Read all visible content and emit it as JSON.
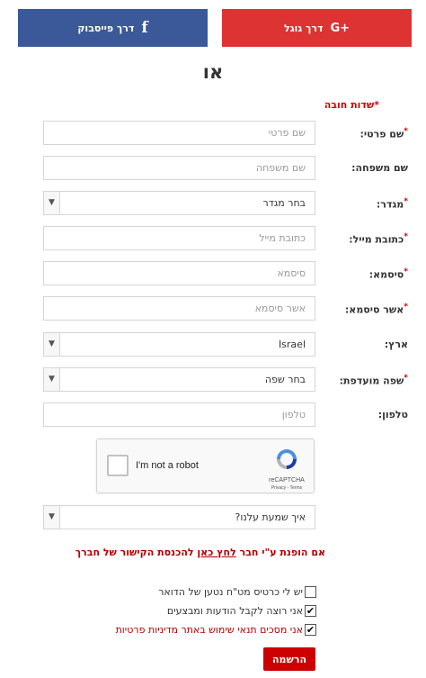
{
  "social": {
    "facebook_label": "דרך פייסבוק",
    "facebook_icon": "f",
    "google_label": "דרך גוגל",
    "google_icon": "G+",
    "facebook_color": "#3b5998",
    "google_color": "#dd3333"
  },
  "or_label": "או",
  "required_note": "שדות חובה",
  "fields": {
    "first_name": {
      "label": "שם פרטי:",
      "placeholder": "שם פרטי",
      "required": true
    },
    "last_name": {
      "label": "שם משפחה:",
      "placeholder": "שם משפחה",
      "required": false
    },
    "gender": {
      "label": "מגדר:",
      "value": "בחר מגדר",
      "required": true
    },
    "email": {
      "label": "כתובת מייל:",
      "placeholder": "כתובת מייל",
      "required": true
    },
    "password": {
      "label": "סיסמא:",
      "placeholder": "סיסמא",
      "required": true
    },
    "confirm_password": {
      "label": "אשר סיסמא:",
      "placeholder": "אשר סיסמא",
      "required": true
    },
    "country": {
      "label": "ארץ:",
      "value": "Israel",
      "required": false
    },
    "language": {
      "label": "שפה מועדפת:",
      "value": "בחר שפה",
      "required": true
    },
    "phone": {
      "label": "טלפון:",
      "placeholder": "טלפון",
      "required": false
    }
  },
  "recaptcha": {
    "text": "I'm not a robot",
    "brand": "reCAPTCHA",
    "links": "Privacy - Terms"
  },
  "referral_select": "איך שמעת עלנו?",
  "invite": {
    "prefix": "אם הופנת ע\"י חבר",
    "link": "לחץ כאן",
    "suffix": "להכנסת הקישור של חברך"
  },
  "checkboxes": [
    {
      "label": "יש לי כרטיס מט\"ח נטען של הדואר",
      "checked": false
    },
    {
      "label": "אני רוצה לקבל הודעות ומבצעים",
      "checked": true
    },
    {
      "label": "אני מסכים תנאי שימוש באתר מדיניות פרטיות",
      "checked": true
    }
  ],
  "submit_label": "הרשמה",
  "accent_color": "#cc0000"
}
